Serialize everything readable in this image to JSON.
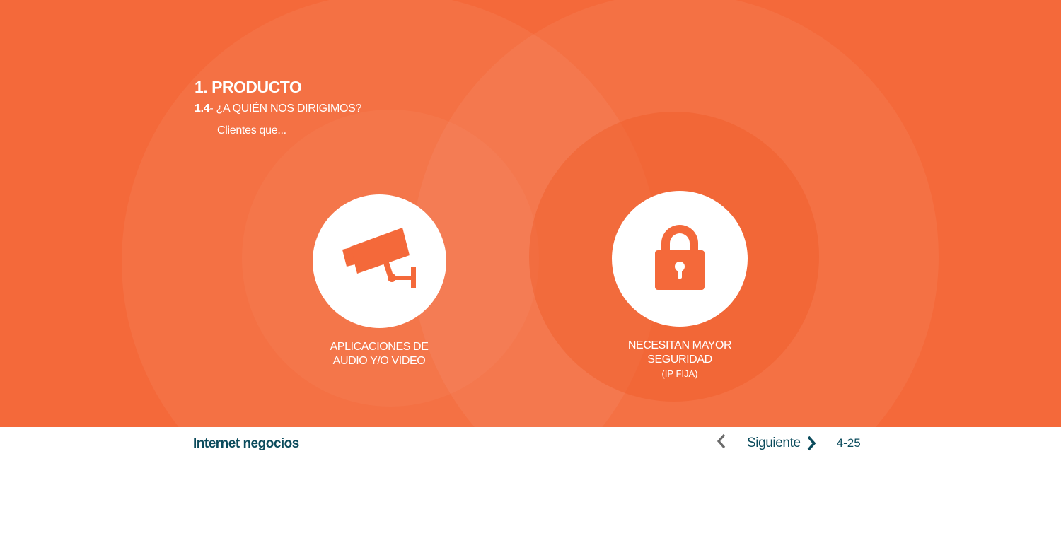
{
  "colors": {
    "accent": "#f4693a",
    "brand_text": "#0b4b5c",
    "icon": "#f4693a"
  },
  "content": {
    "section_title": "1. PRODUCTO",
    "subsection_number": "1.4",
    "subsection_title": "- ¿A QUIÉN NOS DIRIGIMOS?",
    "intro": "Clientes que...",
    "features": [
      {
        "icon": "security-camera-icon",
        "label": "APLICACIONES DE\nAUDIO Y/O VIDEO",
        "note": ""
      },
      {
        "icon": "padlock-icon",
        "label": "NECESITAN MAYOR\nSEGURIDAD",
        "note": "(IP FIJA)"
      }
    ]
  },
  "footer": {
    "brand": "Internet negocios",
    "prev_icon": "chevron-left-icon",
    "next_label": "Siguiente",
    "next_icon": "chevron-right-icon",
    "page_indicator": "4-25"
  }
}
